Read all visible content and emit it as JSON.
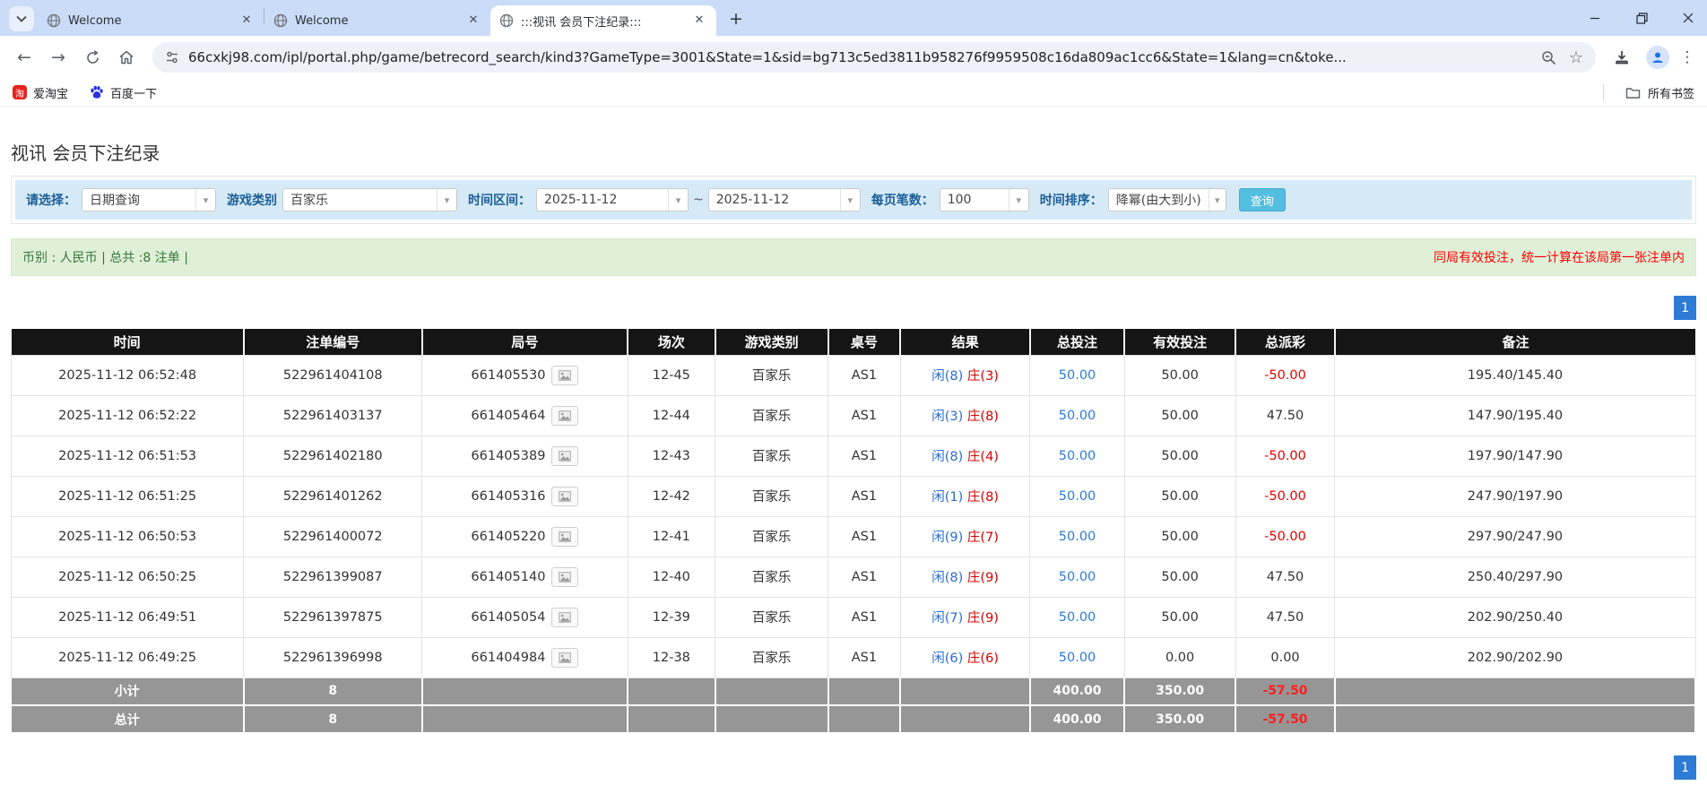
{
  "icons": {
    "caret": "▾",
    "close": "✕",
    "plus": "+",
    "back": "←",
    "forward": "→",
    "kebab": "⋮",
    "star": "☆",
    "minimize": "—",
    "taobao": "淘"
  },
  "browser": {
    "tabs": [
      {
        "title": "Welcome"
      },
      {
        "title": "Welcome"
      },
      {
        "title": ":::视讯 会员下注纪录:::"
      }
    ],
    "url": "66cxkj98.com/ipl/portal.php/game/betrecord_search/kind3?GameType=3001&State=1&sid=bg713c5ed3811b958276f9959508c16da809ac1cc6&State=1&lang=cn&toke...",
    "bookmarks": [
      {
        "label": "爱淘宝"
      },
      {
        "label": "百度一下"
      }
    ],
    "all_bookmarks_label": "所有书签"
  },
  "page": {
    "title": "视讯 会员下注纪录",
    "filters": {
      "select_label": "请选择：",
      "select_value": "日期查询",
      "game_type_label": "游戏类别",
      "game_type_value": "百家乐",
      "date_range_label": "时间区间：",
      "date_from": "2025-11-12",
      "tilde": "~",
      "date_to": "2025-11-12",
      "page_size_label": "每页笔数：",
      "page_size_value": "100",
      "sort_label": "时间排序：",
      "sort_value": "降幂(由大到小)",
      "search_button": "查询"
    },
    "summary_bar": {
      "left": "币别 : 人民币 | 总共 :8 注单 |",
      "right": "同局有效投注，统一计算在该局第一张注单内"
    },
    "pagination": "1",
    "table": {
      "headers": [
        "时间",
        "注单编号",
        "局号",
        "场次",
        "游戏类别",
        "桌号",
        "结果",
        "总投注",
        "有效投注",
        "总派彩",
        "备注"
      ],
      "rows": [
        {
          "time": "2025-11-12 06:52:48",
          "bet_id": "522961404108",
          "round": "661405530",
          "session": "12-45",
          "game": "百家乐",
          "table": "AS1",
          "result_player": "闲(8)",
          "result_banker": "庄(3)",
          "total_bet": "50.00",
          "valid_bet": "50.00",
          "payout": "-50.00",
          "note": "195.40/145.40"
        },
        {
          "time": "2025-11-12 06:52:22",
          "bet_id": "522961403137",
          "round": "661405464",
          "session": "12-44",
          "game": "百家乐",
          "table": "AS1",
          "result_player": "闲(3)",
          "result_banker": "庄(8)",
          "total_bet": "50.00",
          "valid_bet": "50.00",
          "payout": "47.50",
          "note": "147.90/195.40"
        },
        {
          "time": "2025-11-12 06:51:53",
          "bet_id": "522961402180",
          "round": "661405389",
          "session": "12-43",
          "game": "百家乐",
          "table": "AS1",
          "result_player": "闲(8)",
          "result_banker": "庄(4)",
          "total_bet": "50.00",
          "valid_bet": "50.00",
          "payout": "-50.00",
          "note": "197.90/147.90"
        },
        {
          "time": "2025-11-12 06:51:25",
          "bet_id": "522961401262",
          "round": "661405316",
          "session": "12-42",
          "game": "百家乐",
          "table": "AS1",
          "result_player": "闲(1)",
          "result_banker": "庄(8)",
          "total_bet": "50.00",
          "valid_bet": "50.00",
          "payout": "-50.00",
          "note": "247.90/197.90"
        },
        {
          "time": "2025-11-12 06:50:53",
          "bet_id": "522961400072",
          "round": "661405220",
          "session": "12-41",
          "game": "百家乐",
          "table": "AS1",
          "result_player": "闲(9)",
          "result_banker": "庄(7)",
          "total_bet": "50.00",
          "valid_bet": "50.00",
          "payout": "-50.00",
          "note": "297.90/247.90"
        },
        {
          "time": "2025-11-12 06:50:25",
          "bet_id": "522961399087",
          "round": "661405140",
          "session": "12-40",
          "game": "百家乐",
          "table": "AS1",
          "result_player": "闲(8)",
          "result_banker": "庄(9)",
          "total_bet": "50.00",
          "valid_bet": "50.00",
          "payout": "47.50",
          "note": "250.40/297.90"
        },
        {
          "time": "2025-11-12 06:49:51",
          "bet_id": "522961397875",
          "round": "661405054",
          "session": "12-39",
          "game": "百家乐",
          "table": "AS1",
          "result_player": "闲(7)",
          "result_banker": "庄(9)",
          "total_bet": "50.00",
          "valid_bet": "50.00",
          "payout": "47.50",
          "note": "202.90/250.40"
        },
        {
          "time": "2025-11-12 06:49:25",
          "bet_id": "522961396998",
          "round": "661404984",
          "session": "12-38",
          "game": "百家乐",
          "table": "AS1",
          "result_player": "闲(6)",
          "result_banker": "庄(6)",
          "total_bet": "50.00",
          "valid_bet": "0.00",
          "payout": "0.00",
          "note": "202.90/202.90"
        }
      ],
      "subtotal": {
        "label": "小计",
        "count": "8",
        "total_bet": "400.00",
        "valid_bet": "350.00",
        "payout": "-57.50"
      },
      "total": {
        "label": "总计",
        "count": "8",
        "total_bet": "400.00",
        "valid_bet": "350.00",
        "payout": "-57.50"
      }
    }
  }
}
